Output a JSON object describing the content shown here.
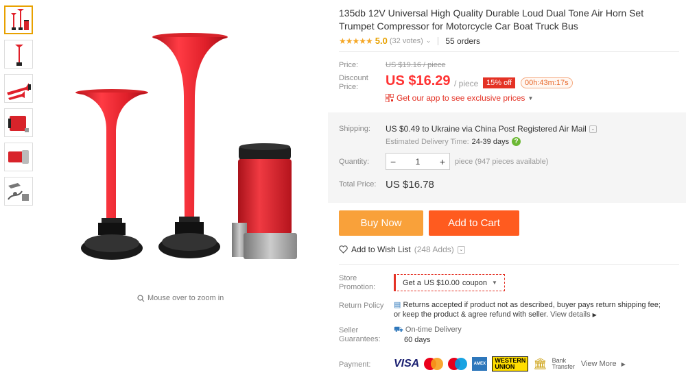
{
  "thumbnails": [
    "thumb-horns-set",
    "thumb-long-horn",
    "thumb-horns-side",
    "thumb-compressor",
    "thumb-compressor-angle",
    "thumb-accessories"
  ],
  "zoom_hint": "Mouse over to zoom in",
  "title": "135db 12V Universal High Quality Durable Loud Dual Tone Air Horn Set Trumpet Compressor for Motorcycle Car Boat Truck Bus",
  "rating": {
    "stars": "★★★★★",
    "value": "5.0",
    "votes": "(32 votes)",
    "orders": "55 orders"
  },
  "price": {
    "price_label": "Price:",
    "original": "US $19.16 / piece",
    "discount_label_1": "Discount",
    "discount_label_2": "Price:",
    "current": "US $16.29",
    "per": "/ piece",
    "off": "15% off",
    "timer": "00h:43m:17s",
    "app_promo": "Get our app to see exclusive prices"
  },
  "shipping": {
    "label": "Shipping:",
    "value": "US $0.49 to Ukraine via China Post Registered Air Mail",
    "est_label": "Estimated Delivery Time:",
    "est_value": "24-39 days"
  },
  "quantity": {
    "label": "Quantity:",
    "minus": "−",
    "value": "1",
    "plus": "+",
    "note": "piece (947 pieces available)"
  },
  "total": {
    "label": "Total Price:",
    "value": "US $16.78"
  },
  "actions": {
    "buy_now": "Buy Now",
    "add_to_cart": "Add to Cart",
    "wishlist": "Add to Wish List",
    "wishlist_count": "(248 Adds)"
  },
  "store_promotion": {
    "label_1": "Store",
    "label_2": "Promotion:",
    "coupon_prefix": "Get a ",
    "coupon_value": "US $10.00",
    "coupon_suffix": " coupon"
  },
  "return_policy": {
    "label": "Return Policy",
    "line1": "Returns accepted if product not as described, buyer pays return shipping fee;",
    "line2": "or keep the product & agree refund with seller.",
    "link": "View details"
  },
  "guarantees": {
    "label_1": "Seller",
    "label_2": "Guarantees:",
    "title": "On-time Delivery",
    "days": "60 days"
  },
  "payment": {
    "label": "Payment:",
    "visa": "VISA",
    "amex": "AMEX",
    "wu_1": "WESTERN",
    "wu_2": "UNION",
    "bank_1": "Bank",
    "bank_2": "Transfer",
    "more": "View More"
  },
  "colors": {
    "accent_red": "#f33",
    "buy_now": "#f9a13a",
    "add_to_cart": "#ff5b1f",
    "horn_red": "#e0202a"
  }
}
